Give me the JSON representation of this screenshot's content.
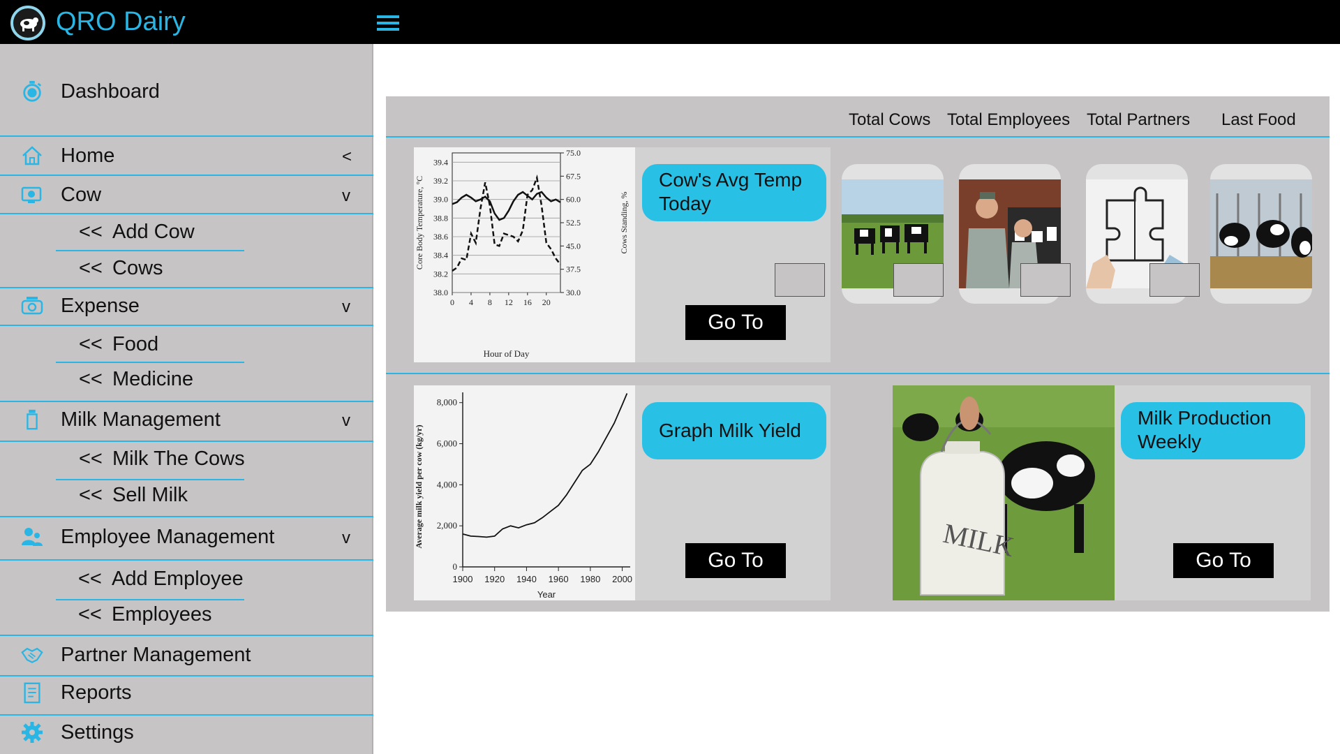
{
  "app": {
    "title": "QRO Dairy"
  },
  "sidebar": {
    "dashboard": "Dashboard",
    "home": {
      "label": "Home",
      "chevron": "<"
    },
    "cow": {
      "label": "Cow",
      "chevron": "v",
      "items": [
        "Add Cow",
        "Cows"
      ]
    },
    "expense": {
      "label": "Expense",
      "chevron": "v",
      "items": [
        "Food",
        "Medicine"
      ]
    },
    "milk": {
      "label": "Milk Management",
      "chevron": "v",
      "items": [
        "Milk The Cows",
        "Sell Milk"
      ]
    },
    "employee": {
      "label": "Employee Management",
      "chevron": "v",
      "items": [
        "Add Employee",
        "Employees"
      ]
    },
    "partner": "Partner Management",
    "reports": "Reports",
    "settings": "Settings",
    "sub_arrow": "<<"
  },
  "stats": {
    "headers": [
      "Total Cows",
      "Total Employees",
      "Total Partners",
      "Last Food"
    ]
  },
  "cards": {
    "temp": {
      "title": "Cow's Avg Temp Today",
      "button": "Go To"
    },
    "yield": {
      "title": "Graph Milk Yield",
      "button": "Go To"
    },
    "production": {
      "title": "Milk Production Weekly",
      "button": "Go To"
    }
  },
  "chart_data": [
    {
      "type": "line",
      "xlabel": "Hour of Day",
      "ylabel": "Core Body Temperature, °C",
      "y2label": "Cows Standing, %",
      "xticks": [
        0,
        4,
        8,
        12,
        16,
        20
      ],
      "yticks": [
        "38.0",
        "38.2",
        "38.4",
        "38.6",
        "38.8",
        "39.0",
        "39.2",
        "39.4"
      ],
      "y2ticks": [
        "30.0",
        "37.5",
        "45.0",
        "52.5",
        "60.0",
        "67.5",
        "75.0"
      ],
      "ylim": [
        38.0,
        39.5
      ],
      "y2lim": [
        30.0,
        75.0
      ],
      "series": [
        {
          "axis": "left",
          "style": "solid",
          "x": [
            0,
            1,
            2,
            3,
            4,
            5,
            6,
            7,
            8,
            9,
            10,
            11,
            12,
            13,
            14,
            15,
            16,
            17,
            18,
            19,
            20,
            21,
            22,
            23
          ],
          "y": [
            38.95,
            38.97,
            39.02,
            39.05,
            39.02,
            38.98,
            39.0,
            39.03,
            38.98,
            38.85,
            38.78,
            38.8,
            38.88,
            38.98,
            39.05,
            39.08,
            39.04,
            39.0,
            39.06,
            39.08,
            39.02,
            38.98,
            39.0,
            38.97
          ]
        },
        {
          "axis": "right",
          "style": "dashed",
          "x": [
            0,
            1,
            2,
            3,
            4,
            5,
            6,
            7,
            8,
            9,
            10,
            11,
            12,
            13,
            14,
            15,
            16,
            17,
            18,
            19,
            20,
            21,
            22,
            23
          ],
          "y": [
            37.0,
            38.0,
            41.0,
            40.5,
            49.0,
            46.0,
            57.0,
            65.5,
            58.0,
            45.5,
            45.0,
            49.0,
            48.5,
            48.0,
            46.5,
            50.0,
            61.5,
            63.0,
            67.0,
            58.0,
            46.0,
            44.0,
            41.0,
            39.0
          ]
        }
      ]
    },
    {
      "type": "line",
      "xlabel": "Year",
      "ylabel": "Average milk yield per cow (kg/yr)",
      "xticks": [
        1900,
        1920,
        1940,
        1960,
        1980,
        2000
      ],
      "yticks": [
        "0",
        "2,000",
        "4,000",
        "6,000",
        "8,000"
      ],
      "xlim": [
        1900,
        2005
      ],
      "ylim": [
        0,
        8500
      ],
      "series": [
        {
          "x": [
            1900,
            1905,
            1910,
            1915,
            1920,
            1925,
            1930,
            1935,
            1940,
            1945,
            1950,
            1955,
            1960,
            1965,
            1970,
            1975,
            1980,
            1985,
            1990,
            1995,
            2000,
            2003
          ],
          "y": [
            1600,
            1500,
            1480,
            1450,
            1500,
            1850,
            2000,
            1900,
            2050,
            2150,
            2400,
            2700,
            3000,
            3500,
            4100,
            4700,
            5000,
            5600,
            6300,
            7000,
            7900,
            8450
          ]
        }
      ]
    }
  ]
}
